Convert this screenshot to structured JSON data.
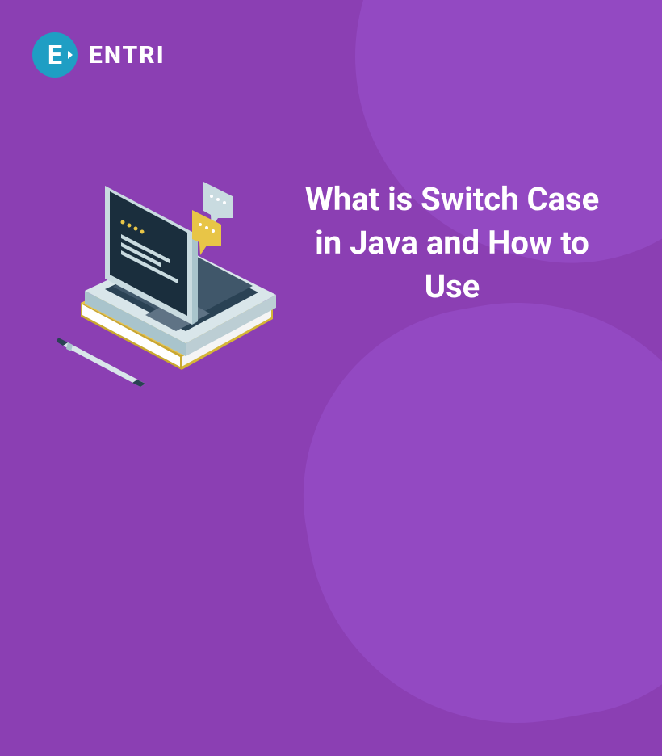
{
  "brand": {
    "logo_letter": "E",
    "name": "ENTRI"
  },
  "heading": "What is Switch Case in Java and How to Use"
}
